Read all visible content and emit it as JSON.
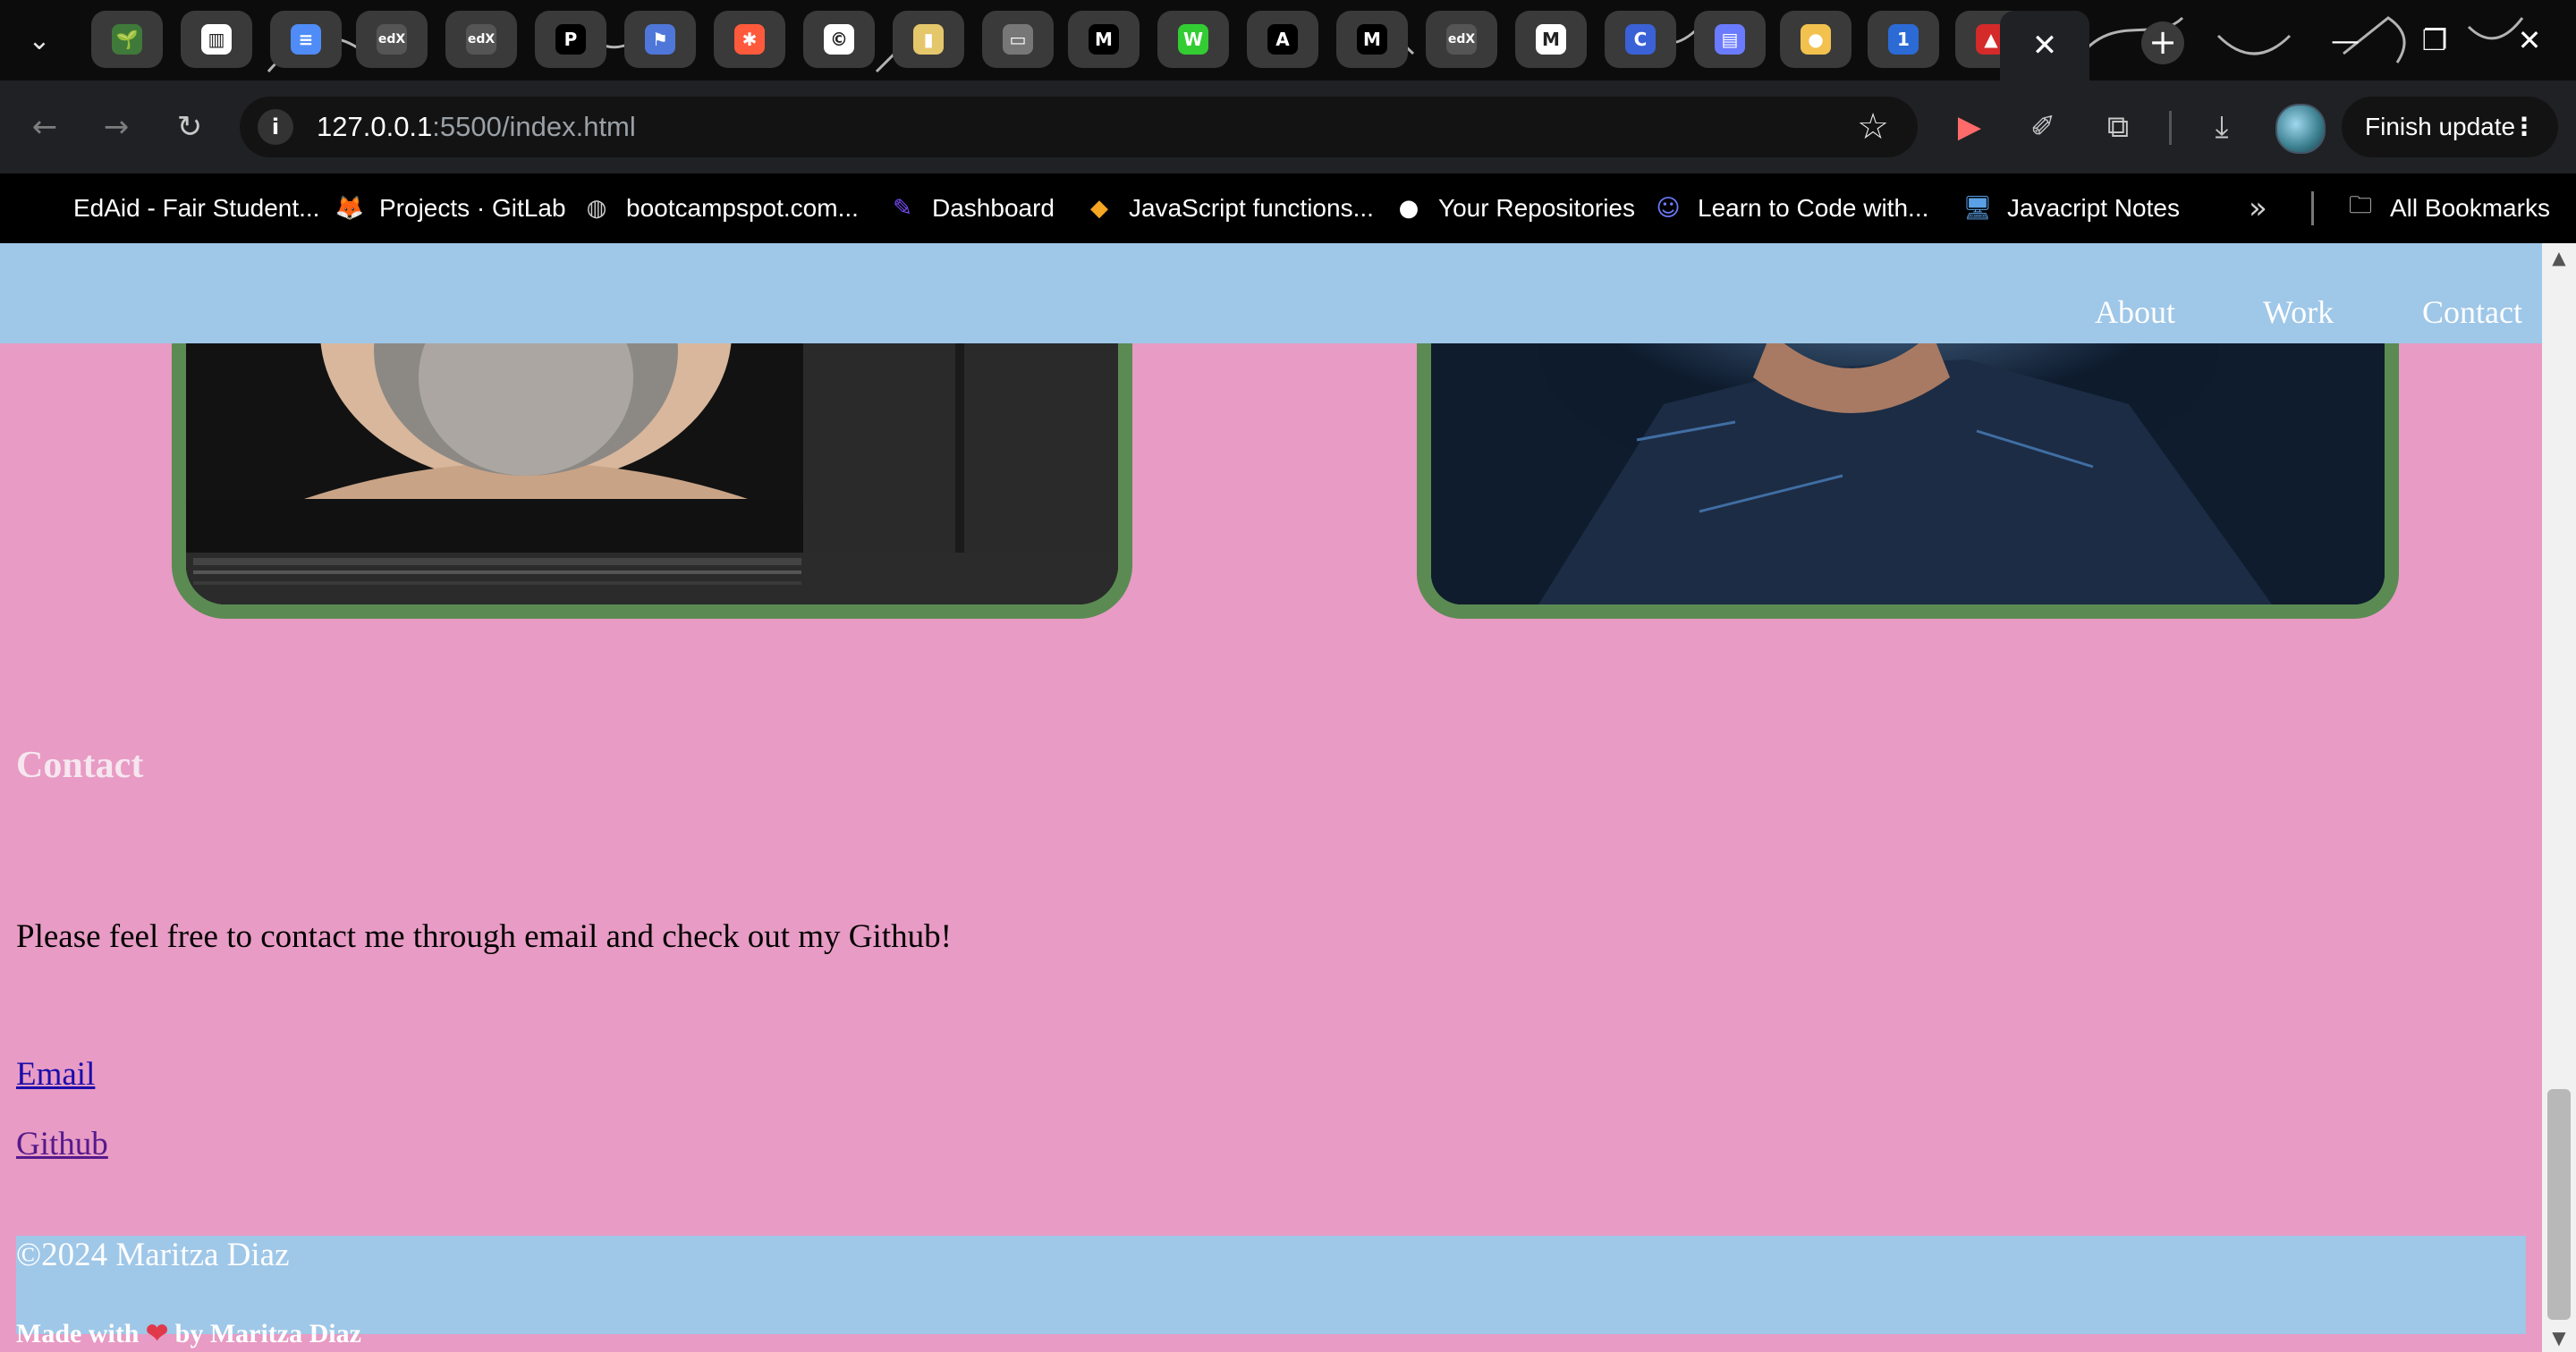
{
  "browser": {
    "tabs": [
      {
        "name": "plant",
        "icon": "plant-icon",
        "color": "#3f7a3a",
        "glyph": "🌱"
      },
      {
        "name": "trello",
        "icon": "trello-icon",
        "color": "#fff",
        "glyph": "▥"
      },
      {
        "name": "google-docs",
        "icon": "docs-icon",
        "color": "#4f8cf7",
        "glyph": "≡"
      },
      {
        "name": "edx-1",
        "icon": "edx-icon",
        "color": "#555",
        "glyph": "edX"
      },
      {
        "name": "edx-2",
        "icon": "edx-icon",
        "color": "#555",
        "glyph": "edX"
      },
      {
        "name": "pandora",
        "icon": "p-icon",
        "color": "#000",
        "glyph": "P"
      },
      {
        "name": "flag",
        "icon": "flag-icon",
        "color": "#4f77d9",
        "glyph": "⚑"
      },
      {
        "name": "asterisk",
        "icon": "asterisk-icon",
        "color": "#ff5a3c",
        "glyph": "✱"
      },
      {
        "name": "c-circle",
        "icon": "c-circle-icon",
        "color": "#fff",
        "glyph": "©"
      },
      {
        "name": "yellow-square",
        "icon": "square-icon",
        "color": "#e5c76b",
        "glyph": "▮"
      },
      {
        "name": "window",
        "icon": "window-icon",
        "color": "#777",
        "glyph": "▭"
      },
      {
        "name": "m-1",
        "icon": "m-icon",
        "color": "#000",
        "glyph": "M"
      },
      {
        "name": "w-circle",
        "icon": "w-icon",
        "color": "#3c3",
        "glyph": "W"
      },
      {
        "name": "a-circle",
        "icon": "a-icon",
        "color": "#000",
        "glyph": "A"
      },
      {
        "name": "m-2",
        "icon": "m-icon",
        "color": "#000",
        "glyph": "M"
      },
      {
        "name": "edx-3",
        "icon": "edx-icon",
        "color": "#555",
        "glyph": "edX"
      },
      {
        "name": "gmail",
        "icon": "gmail-icon",
        "color": "#fff",
        "glyph": "M"
      },
      {
        "name": "c-blue",
        "icon": "c-icon",
        "color": "#3a62d6",
        "glyph": "C"
      },
      {
        "name": "app-window",
        "icon": "window-icon",
        "color": "#6b7bff",
        "glyph": "▤"
      },
      {
        "name": "badge",
        "icon": "badge-icon",
        "color": "#f2c14e",
        "glyph": "●"
      },
      {
        "name": "one",
        "icon": "number-icon",
        "color": "#2c6bd6",
        "glyph": "1"
      },
      {
        "name": "redhat",
        "icon": "redhat-icon",
        "color": "#d42a2a",
        "glyph": "▲"
      }
    ],
    "active_tab_close": "✕",
    "url_host": "127.0.0.1",
    "url_rest": ":5500/index.html",
    "finish_update": "Finish update",
    "bookmarks": [
      {
        "label": "EdAid - Fair Student...",
        "icon": "edaid-icon",
        "glyph": ""
      },
      {
        "label": "Projects · GitLab",
        "icon": "gitlab-icon",
        "glyph": "🦊"
      },
      {
        "label": "bootcampspot.com...",
        "icon": "globe-icon",
        "glyph": "◍"
      },
      {
        "label": "Dashboard",
        "icon": "dashboard-icon",
        "glyph": "✎"
      },
      {
        "label": "JavaScript functions...",
        "icon": "diamond-icon",
        "glyph": "◆"
      },
      {
        "label": "Your Repositories",
        "icon": "github-icon",
        "glyph": "●"
      },
      {
        "label": "Learn to Code with...",
        "icon": "robot-icon",
        "glyph": "☺"
      },
      {
        "label": "Javacript Notes",
        "icon": "monitor-icon",
        "glyph": "🖥"
      }
    ],
    "all_bookmarks": "All Bookmarks"
  },
  "site": {
    "nav": [
      "About",
      "Work",
      "Contact"
    ],
    "contact_heading": "Contact",
    "contact_text": "Please feel free to contact me through email and check out my Github!",
    "email_link": "Email",
    "github_link": "Github",
    "copyright": "©2024 Maritza Diaz",
    "made_with_prefix": "Made with",
    "made_with_suffix": "by Maritza Diaz"
  }
}
